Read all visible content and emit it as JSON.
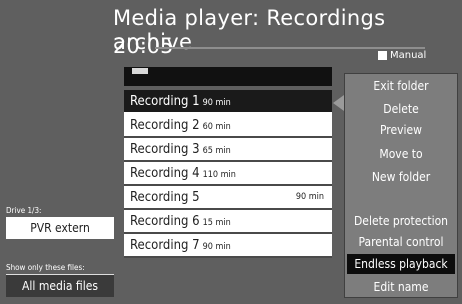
{
  "header": {
    "title": "Media player: Recordings archive",
    "time": "20:05",
    "manual_label": "Manual"
  },
  "recordings": [
    {
      "name": "Recording 1",
      "duration": "90 min",
      "selected": true
    },
    {
      "name": "Recording 2",
      "duration": "60 min"
    },
    {
      "name": "Recording 3",
      "duration": "65 min"
    },
    {
      "name": "Recording 4",
      "duration": "110 min"
    },
    {
      "name": "Recording 5",
      "duration": "90 min",
      "duration_right": true
    },
    {
      "name": "Recording 6",
      "duration": "15 min"
    },
    {
      "name": "Recording 7",
      "duration": "90 min"
    }
  ],
  "menu": [
    {
      "label": "Exit folder"
    },
    {
      "label": "Delete"
    },
    {
      "label": "Preview"
    },
    {
      "label": "Move to"
    },
    {
      "label": "New folder"
    },
    {
      "label": "Delete protection"
    },
    {
      "label": "Parental control"
    },
    {
      "label": "Endless playback",
      "active": true
    },
    {
      "label": "Edit name"
    }
  ],
  "sidebar": {
    "drive_label": "Drive 1/3:",
    "drive_value": "PVR extern",
    "filter_label": "Show only these files:",
    "filter_value": "All media files"
  },
  "colors": {
    "background": "#5f5f5f",
    "list_background": "#ffffff",
    "selection": "#1a1a1a",
    "menu_background": "#7d7d7d"
  }
}
